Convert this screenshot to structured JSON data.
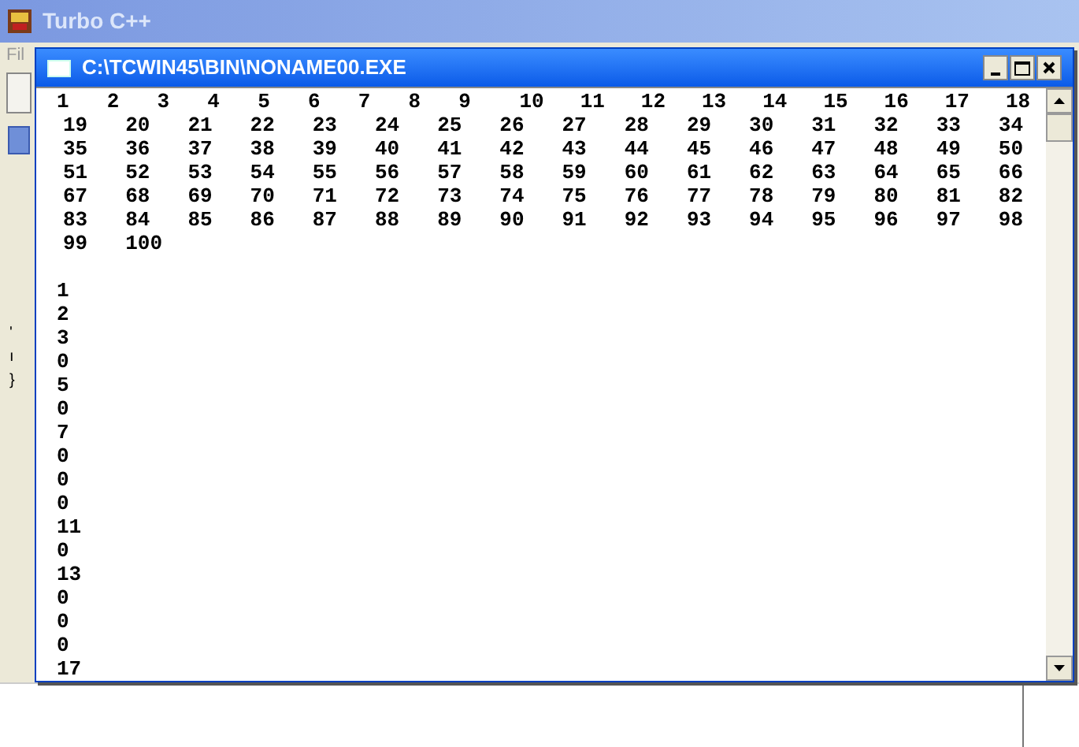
{
  "app_window": {
    "title": "Turbo C++",
    "menu": [
      "Fil"
    ],
    "editor_fragments": [
      "'",
      "ı",
      "}"
    ]
  },
  "console_window": {
    "title": "C:\\TCWIN45\\BIN\\NONAME00.EXE",
    "number_rows": [
      [
        "1",
        "2",
        "3",
        "4",
        "5",
        "6",
        "7",
        "8",
        "9",
        "10",
        "11",
        "12",
        "13",
        "14",
        "15",
        "16",
        "17",
        "18"
      ],
      [
        "19",
        "20",
        "21",
        "22",
        "23",
        "24",
        "25",
        "26",
        "27",
        "28",
        "29",
        "30",
        "31",
        "32",
        "33",
        "34"
      ],
      [
        "35",
        "36",
        "37",
        "38",
        "39",
        "40",
        "41",
        "42",
        "43",
        "44",
        "45",
        "46",
        "47",
        "48",
        "49",
        "50"
      ],
      [
        "51",
        "52",
        "53",
        "54",
        "55",
        "56",
        "57",
        "58",
        "59",
        "60",
        "61",
        "62",
        "63",
        "64",
        "65",
        "66"
      ],
      [
        "67",
        "68",
        "69",
        "70",
        "71",
        "72",
        "73",
        "74",
        "75",
        "76",
        "77",
        "78",
        "79",
        "80",
        "81",
        "82"
      ],
      [
        "83",
        "84",
        "85",
        "86",
        "87",
        "88",
        "89",
        "90",
        "91",
        "92",
        "93",
        "94",
        "95",
        "96",
        "97",
        "98"
      ],
      [
        "99",
        "100"
      ]
    ],
    "column_output": [
      "1",
      "2",
      "3",
      "0",
      "5",
      "0",
      "7",
      "0",
      "0",
      "0",
      "11",
      "0",
      "13",
      "0",
      "0",
      "0",
      "17"
    ]
  }
}
